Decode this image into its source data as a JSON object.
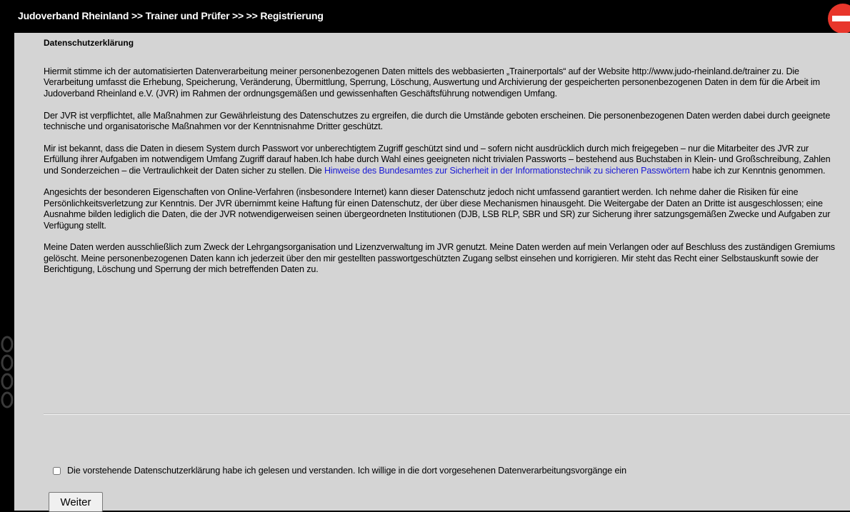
{
  "header": {
    "breadcrumb": "Judoverband Rheinland >> Trainer und Prüfer >> >> Registrierung"
  },
  "section": {
    "title": "Datenschutzerklärung"
  },
  "paragraphs": {
    "p1": "Hiermit stimme ich der automatisierten Datenverarbeitung meiner personenbezogenen Daten mittels des webbasierten „Trainerportals“ auf der Website http://www.judo-rheinland.de/trainer zu. Die Verarbeitung umfasst die Erhebung, Speicherung, Veränderung, Übermittlung, Sperrung, Löschung, Auswertung und Archivierung der gespeicherten personenbezogenen Daten in dem für die Arbeit im Judoverband Rheinland e.V. (JVR) im Rahmen der ordnungsgemäßen und gewissenhaften Geschäftsführung notwendigen Umfang.",
    "p2": "Der JVR ist verpflichtet, alle Maßnahmen zur Gewährleistung des Datenschutzes zu ergreifen, die durch die Umstände geboten erscheinen. Die personenbezogenen Daten werden dabei durch geeignete technische und organisatorische Maßnahmen vor der Kenntnisnahme Dritter geschützt.",
    "p3_before_link": "Mir ist bekannt, dass die Daten in diesem System durch Passwort vor unberechtigtem Zugriff geschützt sind und – sofern nicht ausdrücklich durch mich freigegeben – nur die Mitarbeiter des JVR zur Erfüllung ihrer Aufgaben im notwendigem Umfang Zugriff darauf haben.Ich habe durch Wahl eines geeigneten nicht trivialen Passworts – bestehend aus Buchstaben in Klein- und Großschreibung, Zahlen und Sonderzeichen – die Vertraulichkeit der Daten sicher zu stellen. Die ",
    "p3_link": "Hinweise des Bundesamtes zur Sicherheit in der Informationstechnik zu sicheren Passwörtern",
    "p3_after_link": " habe ich zur Kenntnis genommen.",
    "p4": "Angesichts der besonderen Eigenschaften von Online-Verfahren (insbesondere Internet) kann dieser Datenschutz jedoch nicht umfassend garantiert werden. Ich nehme daher die Risiken für eine Persönlichkeitsverletzung zur Kenntnis. Der JVR übernimmt keine Haftung für einen Datenschutz, der über diese Mechanismen hinausgeht. Die Weitergabe der Daten an Dritte ist ausgeschlossen; eine Ausnahme bilden lediglich die Daten, die der JVR notwendigerweisen seinen übergeordneten Institutionen (DJB, LSB RLP, SBR und SR) zur Sicherung ihrer satzungsgemäßen Zwecke und Aufgaben zur Verfügung stellt.",
    "p5": "Meine Daten werden ausschließlich zum Zweck der Lehrgangsorganisation und Lizenzverwaltung im JVR genutzt. Meine Daten werden auf mein Verlangen oder auf Beschluss des zuständigen Gremiums gelöscht. Meine personenbezogenen Daten kann ich jederzeit über den mir gestellten passwortgeschützten Zugang selbst einsehen und korrigieren. Mir steht das Recht einer Selbstauskunft sowie der Berichtigung, Löschung und Sperrung der mich betreffenden Daten zu."
  },
  "consent": {
    "label": "Die vorstehende Datenschutzerklärung habe ich gelesen und verstanden. Ich willige in die dort vorgesehenen Datenverarbeitungsvorgänge ein",
    "checked": false
  },
  "actions": {
    "next_label": "Weiter"
  },
  "icons": {
    "header_right": "stop-icon",
    "left_edge": "decorative-chain-icon"
  },
  "colors": {
    "panel_background": "#d4d4d4",
    "header_background": "#000000",
    "link": "#1a1ad6",
    "stop_icon": "#e8362b"
  }
}
